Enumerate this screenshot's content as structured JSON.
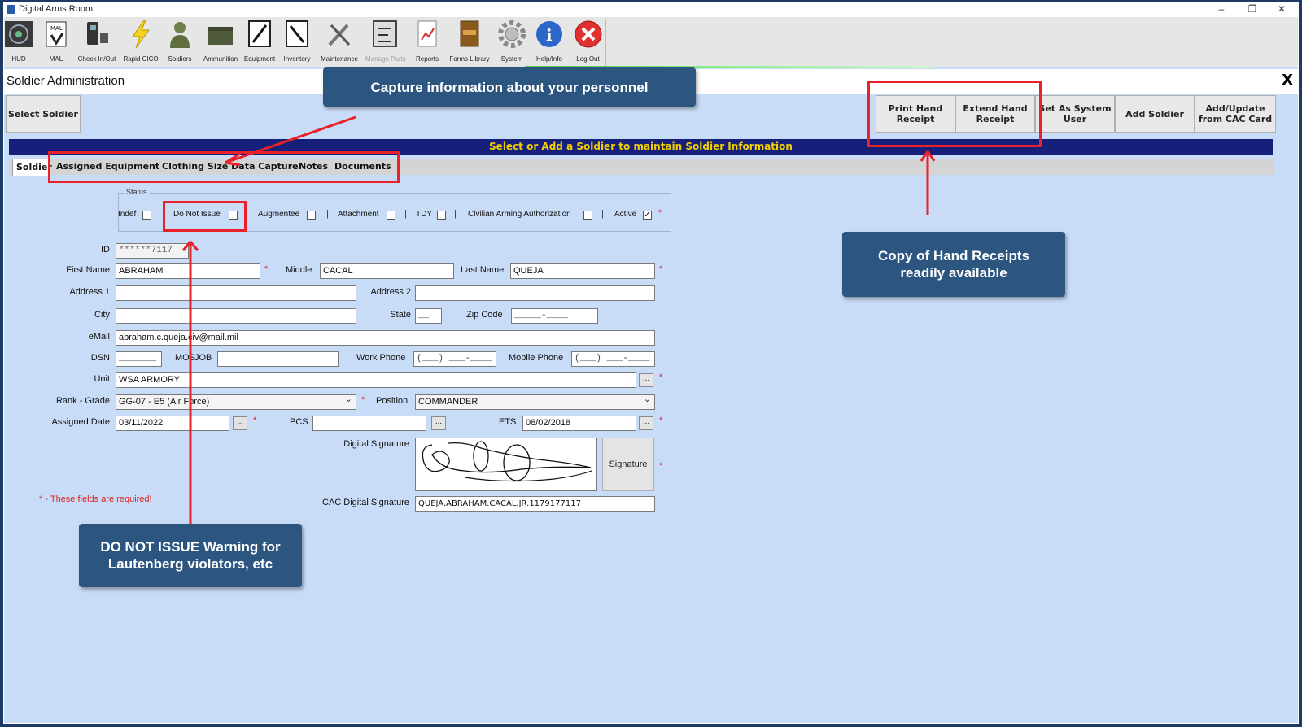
{
  "window": {
    "title": "Digital Arms Room",
    "minimize": "–",
    "restore": "❐",
    "close": "✕"
  },
  "toolbar": {
    "items": [
      {
        "label": "HUD",
        "icon": "hud-icon"
      },
      {
        "label": "MAL",
        "icon": "mal-icon"
      },
      {
        "label": "Check In/Out",
        "icon": "check-in-out-icon"
      },
      {
        "label": "Rapid CICO",
        "icon": "lightning-icon"
      },
      {
        "label": "Soldiers",
        "icon": "soldier-icon"
      },
      {
        "label": "Ammunition",
        "icon": "ammo-box-icon"
      },
      {
        "label": "Equipment",
        "icon": "rifle-icon"
      },
      {
        "label": "Inventory",
        "icon": "inventory-icon"
      },
      {
        "label": "Maintenance",
        "icon": "tools-icon"
      },
      {
        "label": "Manage Parts",
        "icon": "parts-icon"
      },
      {
        "label": "Reports",
        "icon": "report-icon"
      },
      {
        "label": "Forms Library",
        "icon": "book-icon"
      },
      {
        "label": "System",
        "icon": "gear-icon"
      },
      {
        "label": "Help/Info",
        "icon": "info-icon"
      },
      {
        "label": "Log Out",
        "icon": "logout-icon"
      }
    ]
  },
  "admin": {
    "title": "Soldier Administration",
    "close": "X",
    "select_soldier": "Select Soldier",
    "actions": [
      "Print Hand Receipt",
      "Extend Hand Receipt",
      "Set As System User",
      "Add Soldier",
      "Add/Update from CAC Card"
    ],
    "banner": "Select or Add a Soldier to maintain Soldier Information"
  },
  "tabs": [
    "Soldier",
    "Assigned Equipment",
    "Clothing Size Data Capture",
    "Notes",
    "Documents"
  ],
  "status": {
    "legend": "Status",
    "indef": "Indef",
    "do_not_issue": "Do Not Issue",
    "augmentee": "Augmentee",
    "attachment": "Attachment",
    "tdy": "TDY",
    "civilian": "Civilian Arming Authorization",
    "active": "Active",
    "active_checked": "✓"
  },
  "form": {
    "id_label": "ID",
    "id_value": "******7117",
    "first_name_label": "First Name",
    "first_name": "ABRAHAM",
    "middle_label": "Middle",
    "middle": "CACAL",
    "last_name_label": "Last Name",
    "last_name": "QUEJA",
    "address1_label": "Address 1",
    "address1": "",
    "address2_label": "Address 2",
    "address2": "",
    "city_label": "City",
    "city": "",
    "state_label": "State",
    "state": "__",
    "zip_label": "Zip Code",
    "zip": "_____-____",
    "email_label": "eMail",
    "email": "abraham.c.queja.civ@mail.mil",
    "dsn_label": "DSN",
    "dsn": "_______",
    "mos_label": "MOS",
    "job_label": "JOB",
    "job": "",
    "work_phone_label": "Work Phone",
    "work_phone": "(___) ___-____",
    "mobile_phone_label": "Mobile Phone",
    "mobile_phone": "(___) ___-____",
    "unit_label": "Unit",
    "unit": "WSA ARMORY",
    "rank_label": "Rank - Grade",
    "rank": "GG-07 - E5 (Air Force)",
    "position_label": "Position",
    "position": "COMMANDER",
    "assigned_date_label": "Assigned Date",
    "assigned_date": "03/11/2022",
    "pcs_label": "PCS",
    "pcs": "",
    "ets_label": "ETS",
    "ets": "08/02/2018",
    "digital_signature_label": "Digital Signature",
    "signature_button": "Signature",
    "cac_label": "CAC Digital Signature",
    "cac_value": "QUEJA.ABRAHAM.CACAL.JR.1179177117",
    "ellipsis": "...",
    "required_mark": "*",
    "required_note": "* - These fields are required!"
  },
  "callouts": {
    "personnel": "Capture information about your personnel",
    "hand_receipts": "Copy of Hand Receipts readily available",
    "do_not_issue": "DO NOT ISSUE Warning for Lautenberg violators, etc"
  },
  "colors": {
    "banner_bg": "#16207a",
    "banner_text": "#f1d000",
    "panel_bg": "#c9dcf7",
    "callout_bg": "#2c5680",
    "annotation_red": "#e8212a"
  }
}
